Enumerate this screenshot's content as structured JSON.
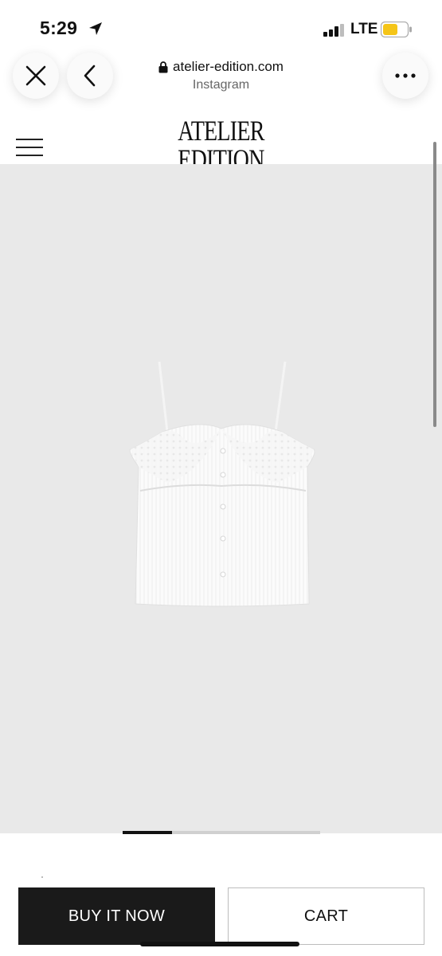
{
  "status_bar": {
    "time": "5:29",
    "carrier": "LTE",
    "location_icon": "location-arrow-icon",
    "battery_color": "#f5c518"
  },
  "browser": {
    "url": "atelier-edition.com",
    "source": "Instagram",
    "close_icon": "close-icon",
    "back_icon": "chevron-left-icon",
    "more_icon": "more-horizontal-icon"
  },
  "site": {
    "logo_line1": "ATELIER",
    "logo_line2": "EDITION",
    "menu_icon": "hamburger-menu-icon"
  },
  "product": {
    "image_icon": "white-camisole-top",
    "gallery_position": 1,
    "gallery_total": 4
  },
  "actions": {
    "buy_now_label": "BUY IT NOW",
    "cart_label": "CART"
  },
  "colors": {
    "product_background": "#e9e9e9",
    "buy_button": "#1a1a1a"
  }
}
